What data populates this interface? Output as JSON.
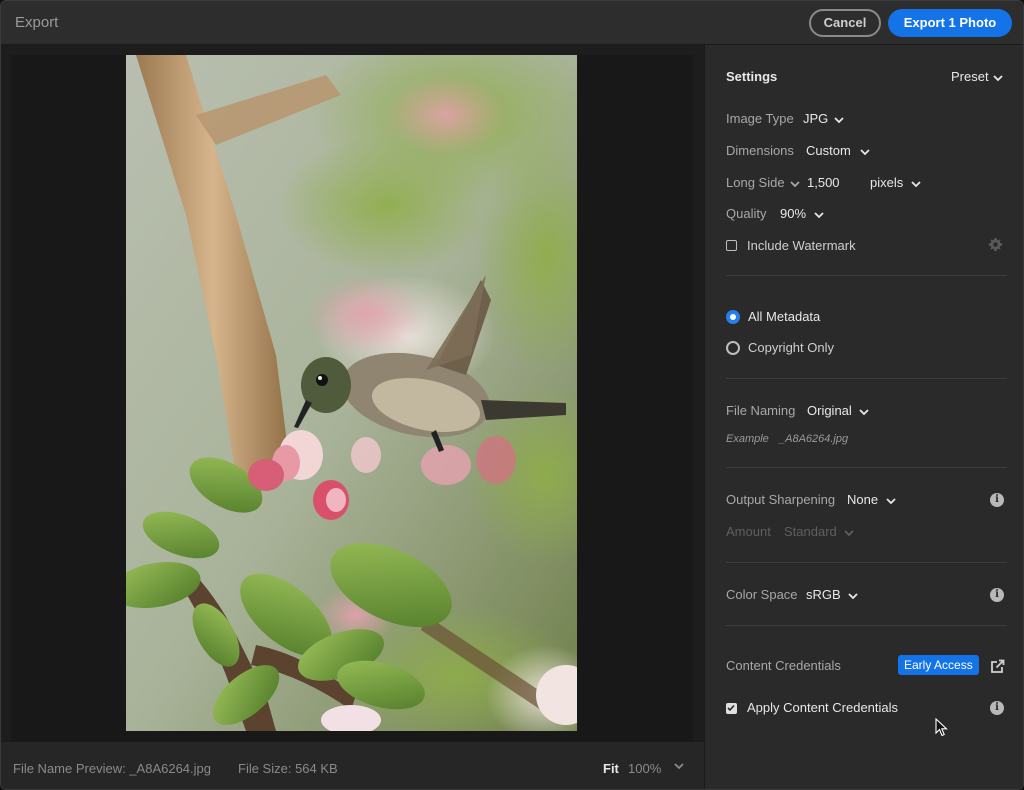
{
  "window": {
    "title": "Export",
    "cancel_label": "Cancel",
    "export_label": "Export 1 Photo"
  },
  "preview": {
    "image_subject": "hummingbird-apple-blossom-photo"
  },
  "bottom_bar": {
    "file_name_preview": "File Name Preview: _A8A6264.jpg",
    "file_size": "File Size: 564 KB",
    "fit_label": "Fit",
    "zoom_label": "100%"
  },
  "settings": {
    "heading": "Settings",
    "preset_label": "Preset",
    "image_type": {
      "label": "Image Type",
      "value": "JPG"
    },
    "dimensions": {
      "label": "Dimensions",
      "value": "Custom"
    },
    "long_side": {
      "label": "Long Side",
      "value": "1,500",
      "unit": "pixels"
    },
    "quality": {
      "label": "Quality",
      "value": "90%"
    },
    "watermark": {
      "label": "Include Watermark",
      "checked": false
    },
    "metadata": {
      "options": [
        "All Metadata",
        "Copyright Only"
      ],
      "selected": "All Metadata"
    },
    "file_naming": {
      "label": "File Naming",
      "value": "Original",
      "example_label": "Example",
      "example_value": "_A8A6264.jpg"
    },
    "output_sharpening": {
      "label": "Output Sharpening",
      "value": "None",
      "amount_label": "Amount",
      "amount_value": "Standard"
    },
    "color_space": {
      "label": "Color Space",
      "value": "sRGB"
    },
    "content_credentials": {
      "label": "Content Credentials",
      "badge": "Early Access",
      "apply_label": "Apply Content Credentials",
      "apply_checked": true
    }
  },
  "colors": {
    "accent": "#1473e6",
    "radio_selected": "#2680eb",
    "panel_bg": "#2a2a2a",
    "window_bg": "#262626"
  },
  "icons": [
    "chevron-down-icon",
    "gear-icon",
    "info-icon",
    "external-link-icon",
    "cursor-pointer-icon"
  ]
}
